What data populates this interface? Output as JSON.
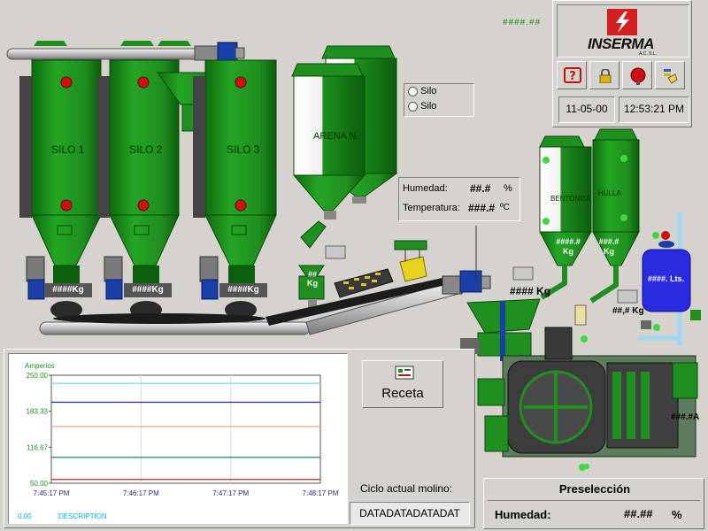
{
  "header": {
    "readout_top": "####.##",
    "brand": "INSERMA",
    "brand_sub": "A.C. S.L.",
    "date": "11-05-00",
    "time": "12:53:21 PM",
    "toolbar": [
      "help-icon",
      "lock-icon",
      "alarm-bell-icon",
      "hand-pointer-icon"
    ]
  },
  "silos": [
    {
      "label": "SILO 1",
      "weight": "####Kg"
    },
    {
      "label": "SILO 2",
      "weight": "####Kg"
    },
    {
      "label": "SILO 3",
      "weight": "####Kg"
    }
  ],
  "arena": {
    "label": "ARENA N.",
    "kg_top": "##",
    "kg_unit": "Kg"
  },
  "silo_select": {
    "options": [
      "Silo",
      "Silo"
    ]
  },
  "sensor": {
    "humedad_label": "Humedad:",
    "humedad_value": "##.#",
    "humedad_unit": "%",
    "temp_label": "Temperatura:",
    "temp_value": "###.#",
    "temp_unit": "ºC"
  },
  "belt_weight": "#### Kg",
  "small_weight": "##,#",
  "small_weight_unit": "Kg",
  "bentonita": {
    "label": "BENTONITA",
    "weight_top": "####.#",
    "weight_unit": "Kg"
  },
  "hulla": {
    "label": "HULLA",
    "weight_top": "###.#",
    "weight_unit": "Kg"
  },
  "water_tank": "####. Lts.",
  "mill_amps": "###.#A",
  "chart_data": {
    "type": "line",
    "ylabel": "Amperios",
    "ylim": [
      50,
      250
    ],
    "yticks": [
      "250.00",
      "183.33",
      "116.67",
      "50.00"
    ],
    "xticks": [
      "7:45:17 PM",
      "7:46:17 PM",
      "7:47:17 PM",
      "7:48:17 PM"
    ],
    "series": [
      {
        "color": "#7fd8d8",
        "values": [
          235,
          235,
          235,
          235
        ]
      },
      {
        "color": "#2020c0",
        "values": [
          200,
          200,
          200,
          200
        ]
      },
      {
        "color": "#e8a070",
        "values": [
          155,
          155,
          155,
          155
        ]
      },
      {
        "color": "#208080",
        "values": [
          98,
          98,
          98,
          98
        ]
      },
      {
        "color": "#c02020",
        "values": [
          57,
          57,
          57,
          57
        ]
      }
    ],
    "footer_value": "0.00",
    "footer_desc": "DESCRIPTION"
  },
  "receta_label": "Receta",
  "ciclo_label": "Ciclo actual molino:",
  "ciclo_value": "DATADATADATADAT",
  "preseleccion": {
    "title": "Preselección",
    "humedad_label": "Humedad:",
    "humedad_value": "##.##",
    "humedad_unit": "%"
  },
  "colors": {
    "silo": "#1f8f1f",
    "silo_dark": "#0b5e0b",
    "panel": "#d6d3ce",
    "brand_red": "#d42020"
  }
}
